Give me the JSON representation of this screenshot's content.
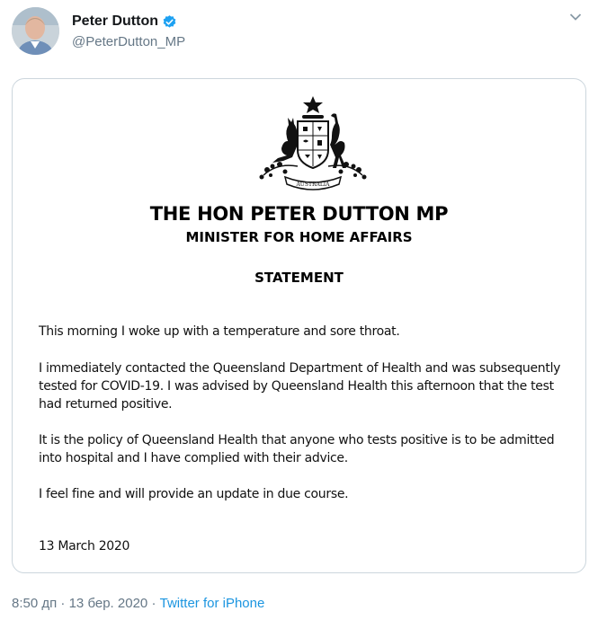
{
  "tweet": {
    "display_name": "Peter Dutton",
    "handle": "@PeterDutton_MP",
    "verified_color": "#1da1f2",
    "time": "8:50 дп",
    "separator": "·",
    "date": "13 бер. 2020",
    "source": "Twitter for iPhone"
  },
  "document": {
    "crest_text": "AUSTRALIA",
    "title": "THE HON PETER DUTTON MP",
    "subtitle": "MINISTER FOR HOME AFFAIRS",
    "heading": "STATEMENT",
    "paragraphs": [
      "This morning I woke up with a temperature and sore throat.",
      "I immediately contacted the Queensland Department of Health and was subsequently tested for COVID-19. I was advised by Queensland Health this afternoon that the test had returned positive.",
      "It is the policy of Queensland Health that anyone who tests positive is to be admitted into hospital and I have complied with their advice.",
      "I feel fine and will provide an update in due course.",
      "13 March 2020"
    ]
  }
}
